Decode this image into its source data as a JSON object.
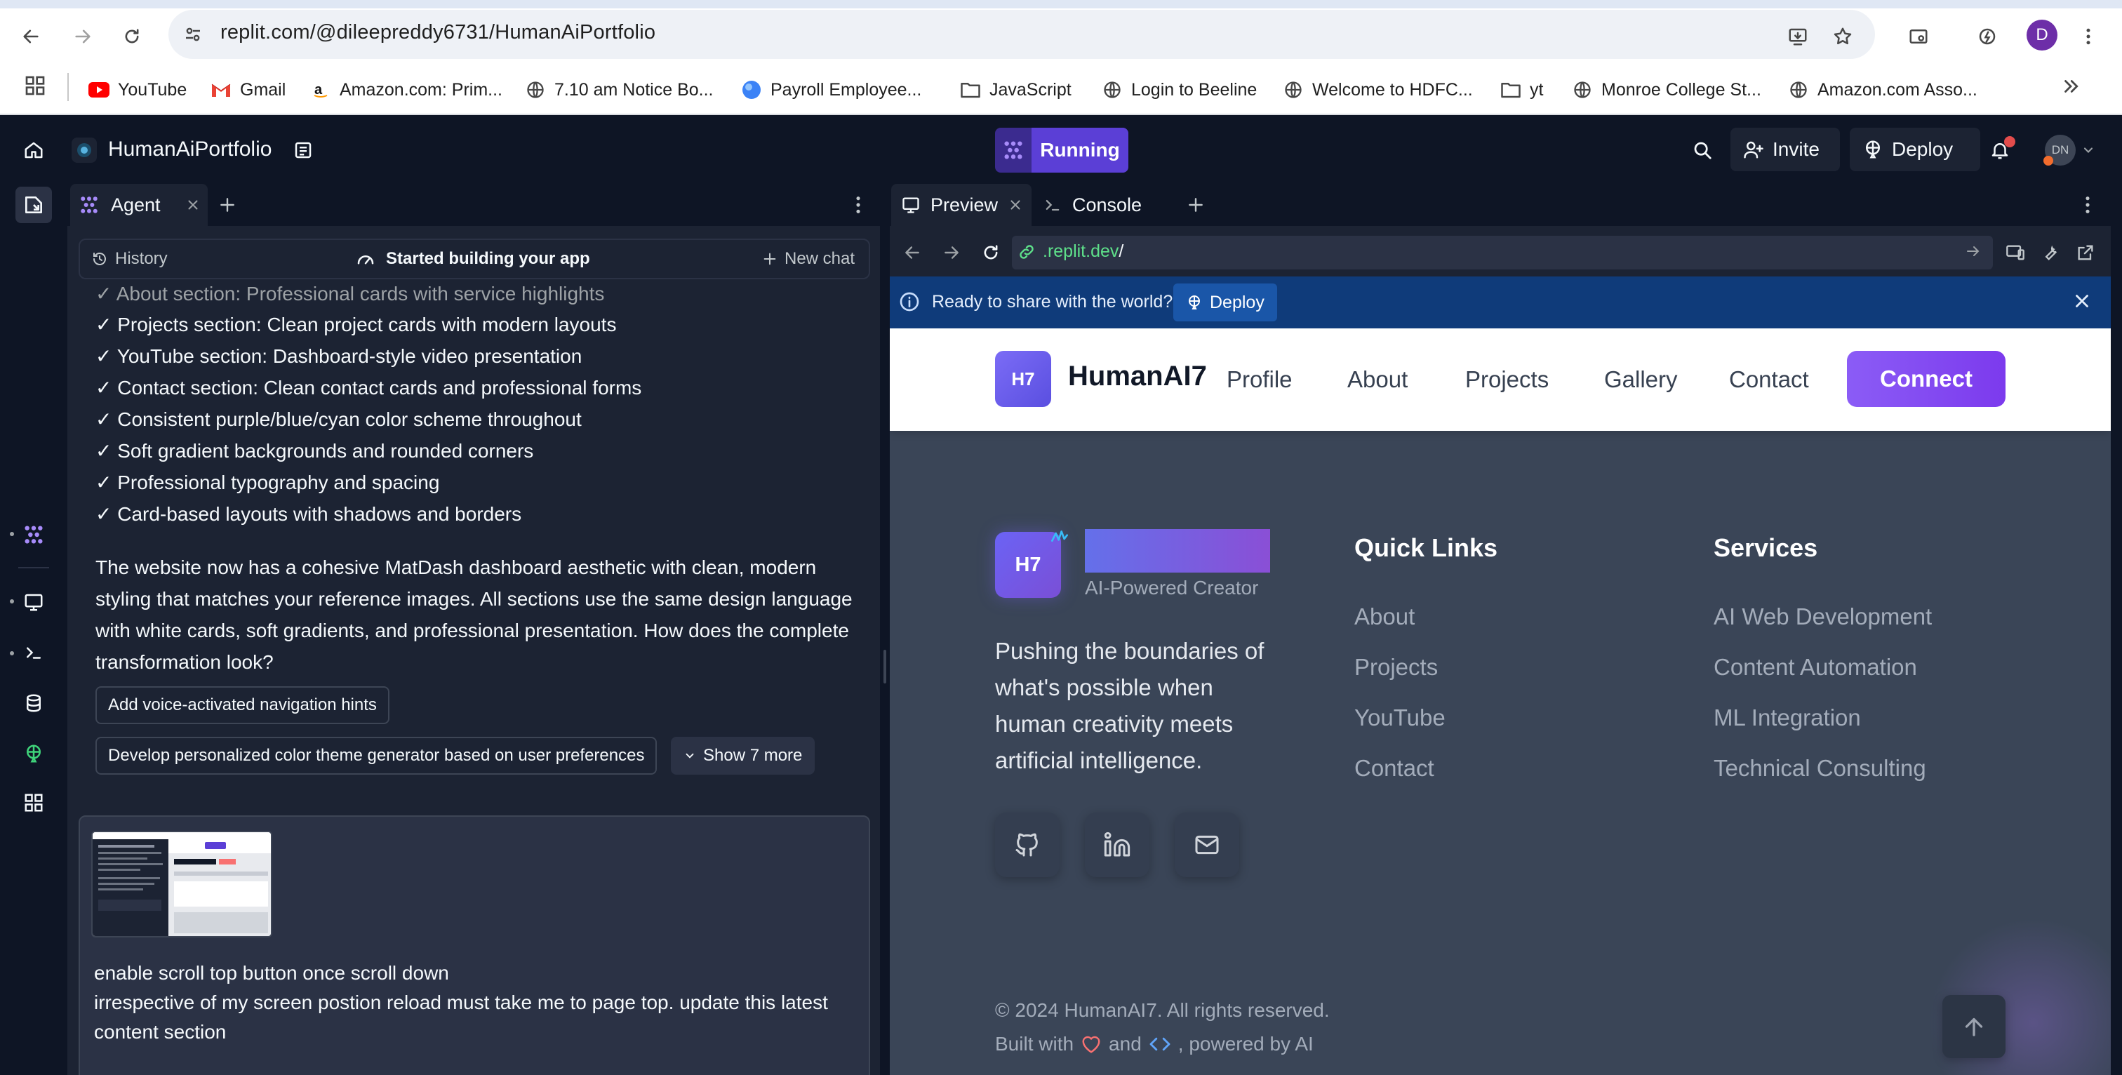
{
  "browser": {
    "url": "replit.com/@dileepreddy6731/HumanAiPortfolio",
    "profile_initial": "D",
    "bookmarks": [
      {
        "label": "YouTube",
        "icon": "youtube-icon"
      },
      {
        "label": "Gmail",
        "icon": "gmail-icon"
      },
      {
        "label": "Amazon.com: Prim...",
        "icon": "amazon-icon"
      },
      {
        "label": "7.10 am Notice Bo...",
        "icon": "globe-icon"
      },
      {
        "label": "Payroll Employee...",
        "icon": "payroll-icon"
      },
      {
        "label": "JavaScript",
        "icon": "folder-icon"
      },
      {
        "label": "Login to Beeline",
        "icon": "globe-icon"
      },
      {
        "label": "Welcome to HDFC...",
        "icon": "globe-icon"
      },
      {
        "label": "yt",
        "icon": "folder-icon"
      },
      {
        "label": "Monroe College St...",
        "icon": "globe-icon"
      },
      {
        "label": "Amazon.com Asso...",
        "icon": "globe-icon"
      }
    ]
  },
  "header": {
    "project_name": "HumanAiPortfolio",
    "run_status": "Running",
    "invite_label": "Invite",
    "deploy_label": "Deploy",
    "user_initials": "DN"
  },
  "agent": {
    "tab_label": "Agent",
    "history_label": "History",
    "status_label": "Started building your app",
    "new_chat_label": "New chat",
    "checklist": [
      "✓ About section: Professional cards with service highlights",
      "✓ Projects section: Clean project cards with modern layouts",
      "✓ YouTube section: Dashboard-style video presentation",
      "✓ Contact section: Clean contact cards and professional forms",
      "✓ Consistent purple/blue/cyan color scheme throughout",
      "✓ Soft gradient backgrounds and rounded corners",
      "✓ Professional typography and spacing",
      "✓ Card-based layouts with shadows and borders"
    ],
    "paragraph": "The website now has a cohesive MatDash dashboard aesthetic with clean, modern styling that matches your reference images. All sections use the same design language with white cards, soft gradients, and professional presentation. How does the complete transformation look?",
    "suggestions": [
      "Add voice-activated navigation hints",
      "Develop personalized color theme generator based on user preferences"
    ],
    "show_more_label": "Show 7 more",
    "user_message_line1": "enable scroll top button once scroll down",
    "user_message_line2": "irrespective of my screen postion reload must take me to page top. update this latest content section"
  },
  "preview": {
    "tab_label": "Preview",
    "console_label": "Console",
    "url_domain": ".replit.dev",
    "url_path": "/",
    "banner_text": "Ready to share with the world?",
    "banner_deploy_label": "Deploy"
  },
  "site": {
    "logo_text": "H7",
    "brand": "HumanAI7",
    "nav_links": [
      "Profile",
      "About",
      "Projects",
      "Gallery",
      "Contact"
    ],
    "connect_label": "Connect",
    "footer": {
      "tagline": "AI-Powered Creator",
      "about": "Pushing the boundaries of what's possible when human creativity meets artificial intelligence.",
      "quick_links_heading": "Quick Links",
      "quick_links": [
        "About",
        "Projects",
        "YouTube",
        "Contact"
      ],
      "services_heading": "Services",
      "services": [
        "AI Web Development",
        "Content Automation",
        "ML Integration",
        "Technical Consulting"
      ],
      "copyright": "© 2024 HumanAI7. All rights reserved.",
      "built_with_prefix": "Built with",
      "built_with_and": "and",
      "built_with_suffix": ", powered by AI"
    }
  },
  "colors": {
    "replit_bg": "#0e1525",
    "replit_panel": "#1c2333",
    "run_accent": "#5b3fd6",
    "banner_blue": "#0f3b7a",
    "site_footer_bg": "#3a4557",
    "connect_purple": "#8b5cf6",
    "url_green": "#5ee08a"
  }
}
